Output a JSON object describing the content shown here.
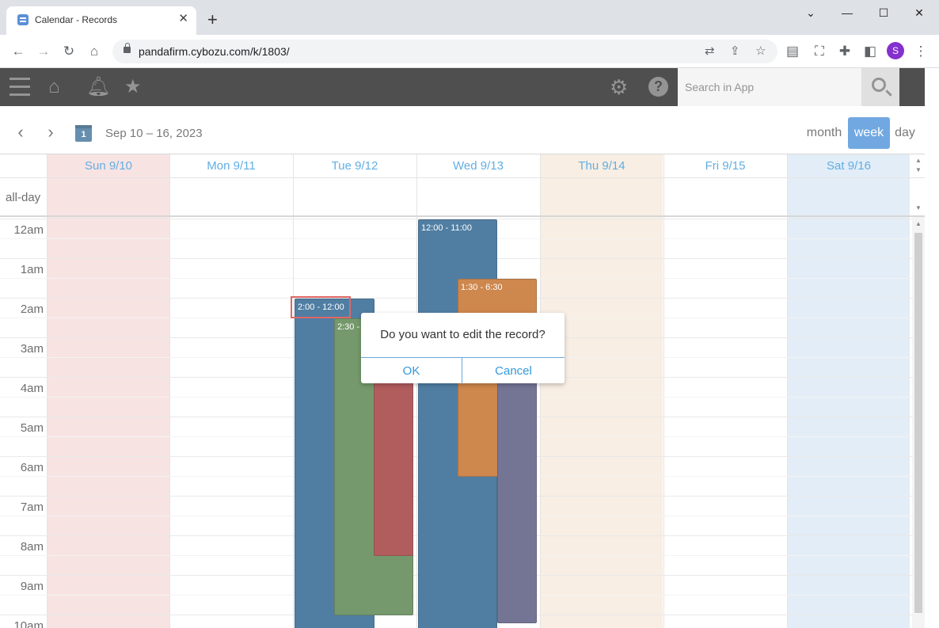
{
  "browser": {
    "tab_title": "Calendar - Records",
    "tab_close": "✕",
    "new_tab": "+",
    "url": "pandafirm.cybozu.com/k/1803/",
    "profile_initial": "S",
    "window_controls": {
      "minimize": "—",
      "maximize": "☐",
      "close": "✕",
      "tab_list": "⌄"
    }
  },
  "app_header": {
    "search_placeholder": "Search in App",
    "help_label": "?"
  },
  "calendar_nav": {
    "calendar_icon_day": "1",
    "date_range": "Sep 10 – 16, 2023",
    "views": {
      "month": "month",
      "week": "week",
      "day": "day"
    },
    "active_view": "week"
  },
  "days": [
    {
      "label": "Sun 9/10",
      "tint": "#f6dcdc"
    },
    {
      "label": "Mon 9/11",
      "tint": "#ffffff"
    },
    {
      "label": "Tue 9/12",
      "tint": "#ffffff"
    },
    {
      "label": "Wed 9/13",
      "tint": "#ffffff"
    },
    {
      "label": "Thu 9/14",
      "tint": "#f7eadb"
    },
    {
      "label": "Fri 9/15",
      "tint": "#ffffff"
    },
    {
      "label": "Sat 9/16",
      "tint": "#dce8f5"
    }
  ],
  "allday_label": "all-day",
  "hours": [
    "12am",
    "1am",
    "2am",
    "3am",
    "4am",
    "5am",
    "6am",
    "7am",
    "8am",
    "9am",
    "10am"
  ],
  "events": [
    {
      "time": "12:00 - 11:00",
      "color": "#1f5a8a"
    },
    {
      "time": "1:30 - 6:30",
      "color": "#c0661b"
    },
    {
      "time": "",
      "color": "#4d4d78"
    },
    {
      "time": "2:00 - 12:00",
      "color": "#1f5a8a"
    },
    {
      "time": "2:30 - ",
      "color": "#4f7d43"
    },
    {
      "time": "",
      "color": "#9b2f30"
    }
  ],
  "dialog": {
    "message": "Do you want to edit the record?",
    "ok_label": "OK",
    "cancel_label": "Cancel"
  }
}
